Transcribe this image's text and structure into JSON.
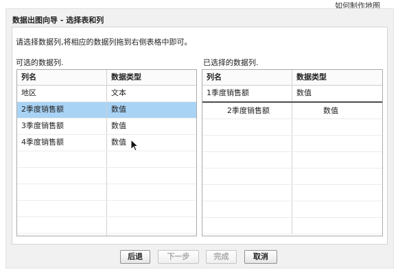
{
  "help_link": "如何制作地图",
  "wizard": {
    "title": "数据出图向导 - 选择表和列",
    "instruction": "请选择数据列,将相应的数据列拖到右侧表格中即可。"
  },
  "available": {
    "caption": "可选的数据列.",
    "headers": {
      "name": "列名",
      "type": "数据类型"
    },
    "rows": [
      {
        "name": "地区",
        "type": "文本"
      },
      {
        "name": "2季度销售额",
        "type": "数值"
      },
      {
        "name": "3季度销售额",
        "type": "数值"
      },
      {
        "name": "4季度销售额",
        "type": "数值"
      }
    ]
  },
  "selected": {
    "caption": "已选择的数据列.",
    "headers": {
      "name": "列名",
      "type": "数据类型"
    },
    "rows": [
      {
        "name": "1季度销售额",
        "type": "数值"
      }
    ],
    "drag_preview": {
      "name": "2季度销售额",
      "type": "数值"
    }
  },
  "buttons": {
    "back": "后退",
    "next": "下一步",
    "finish": "完成",
    "cancel": "取消"
  }
}
